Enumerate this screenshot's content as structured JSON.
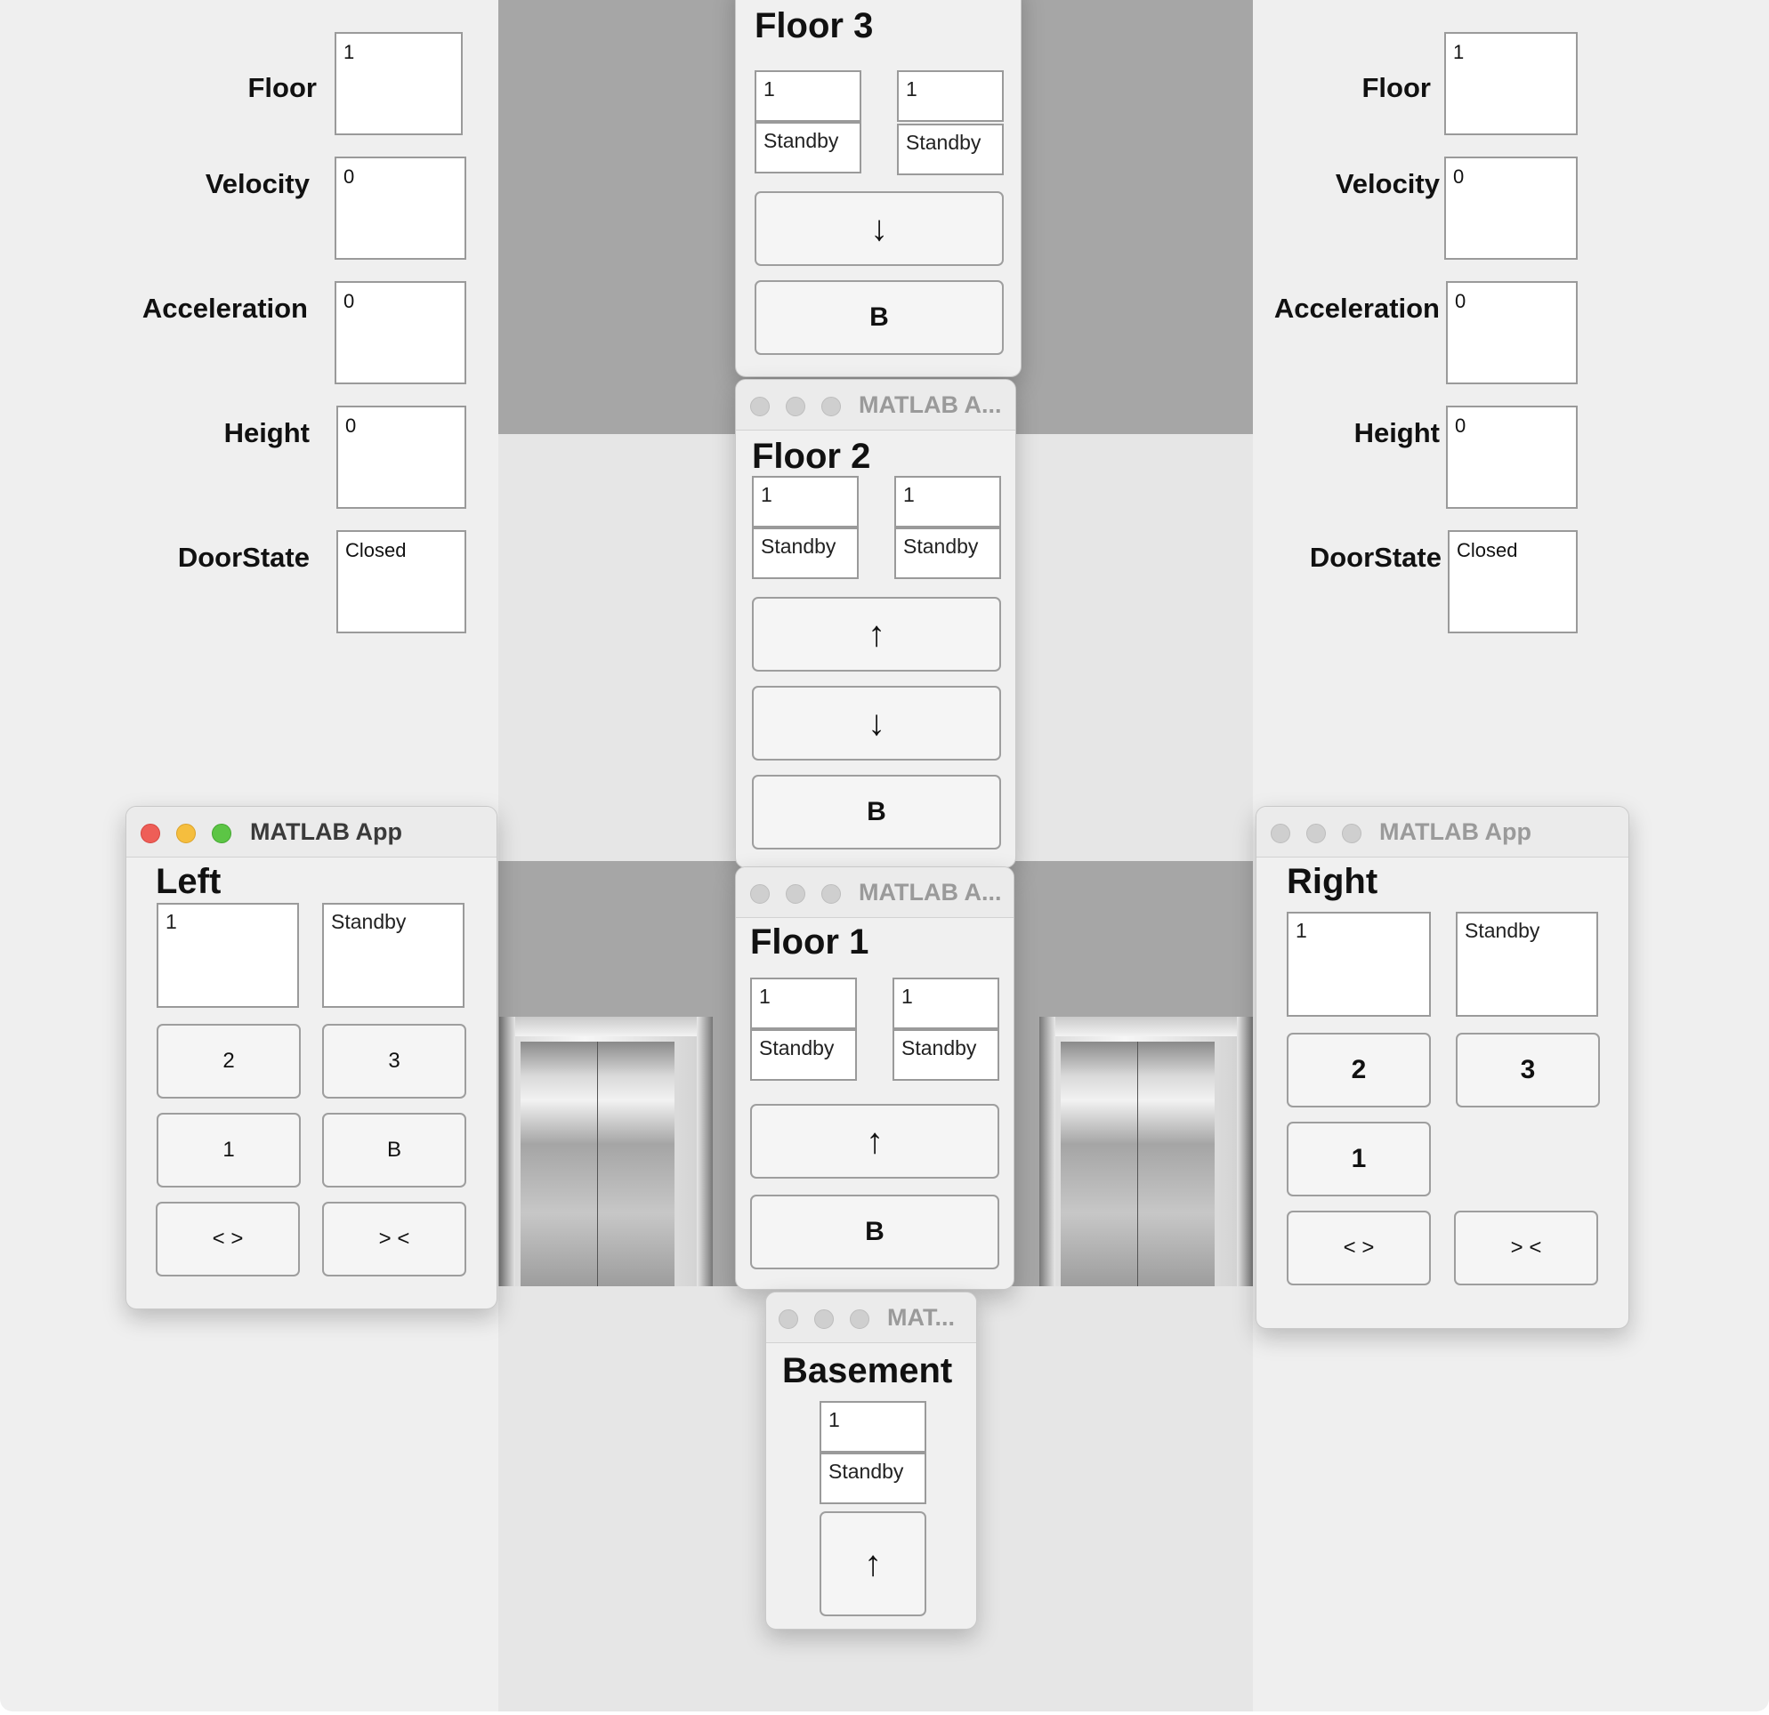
{
  "left_panel": {
    "fields": [
      {
        "label": "Floor",
        "value": "1"
      },
      {
        "label": "Velocity",
        "value": "0"
      },
      {
        "label": "Acceleration",
        "value": "0"
      },
      {
        "label": "Height",
        "value": "0"
      },
      {
        "label": "DoorState",
        "value": "Closed"
      }
    ]
  },
  "right_panel": {
    "fields": [
      {
        "label": "Floor",
        "value": "1"
      },
      {
        "label": "Velocity",
        "value": "0"
      },
      {
        "label": "Acceleration",
        "value": "0"
      },
      {
        "label": "Height",
        "value": "0"
      },
      {
        "label": "DoorState",
        "value": "Closed"
      }
    ]
  },
  "floor3": {
    "heading": "Floor 3",
    "left_floor": "1",
    "left_state": "Standby",
    "right_floor": "1",
    "right_state": "Standby",
    "down_label": "↓",
    "b_label": "B"
  },
  "floor2": {
    "window_title": "MATLAB A...",
    "heading": "Floor 2",
    "left_floor": "1",
    "left_state": "Standby",
    "right_floor": "1",
    "right_state": "Standby",
    "up_label": "↑",
    "down_label": "↓",
    "b_label": "B"
  },
  "floor1": {
    "window_title": "MATLAB A...",
    "heading": "Floor 1",
    "left_floor": "1",
    "left_state": "Standby",
    "right_floor": "1",
    "right_state": "Standby",
    "up_label": "↑",
    "b_label": "B"
  },
  "basement": {
    "window_title": "MAT...",
    "heading": "Basement",
    "floor": "1",
    "state": "Standby",
    "up_label": "↑"
  },
  "left_car": {
    "window_title": "MATLAB App",
    "heading": "Left",
    "floor": "1",
    "state": "Standby",
    "btn_2": "2",
    "btn_3": "3",
    "btn_1": "1",
    "btn_b": "B",
    "open_label": "< >",
    "close_label": "> <"
  },
  "right_car": {
    "window_title": "MATLAB App",
    "heading": "Right",
    "floor": "1",
    "state": "Standby",
    "btn_2": "2",
    "btn_3": "3",
    "btn_1": "1",
    "open_label": "< >",
    "close_label": "> <"
  },
  "colors": {
    "traffic_red": "#ee5e57",
    "traffic_yellow": "#f5be3e",
    "traffic_green": "#5cc545",
    "shaft_gray": "#a6a6a6"
  }
}
